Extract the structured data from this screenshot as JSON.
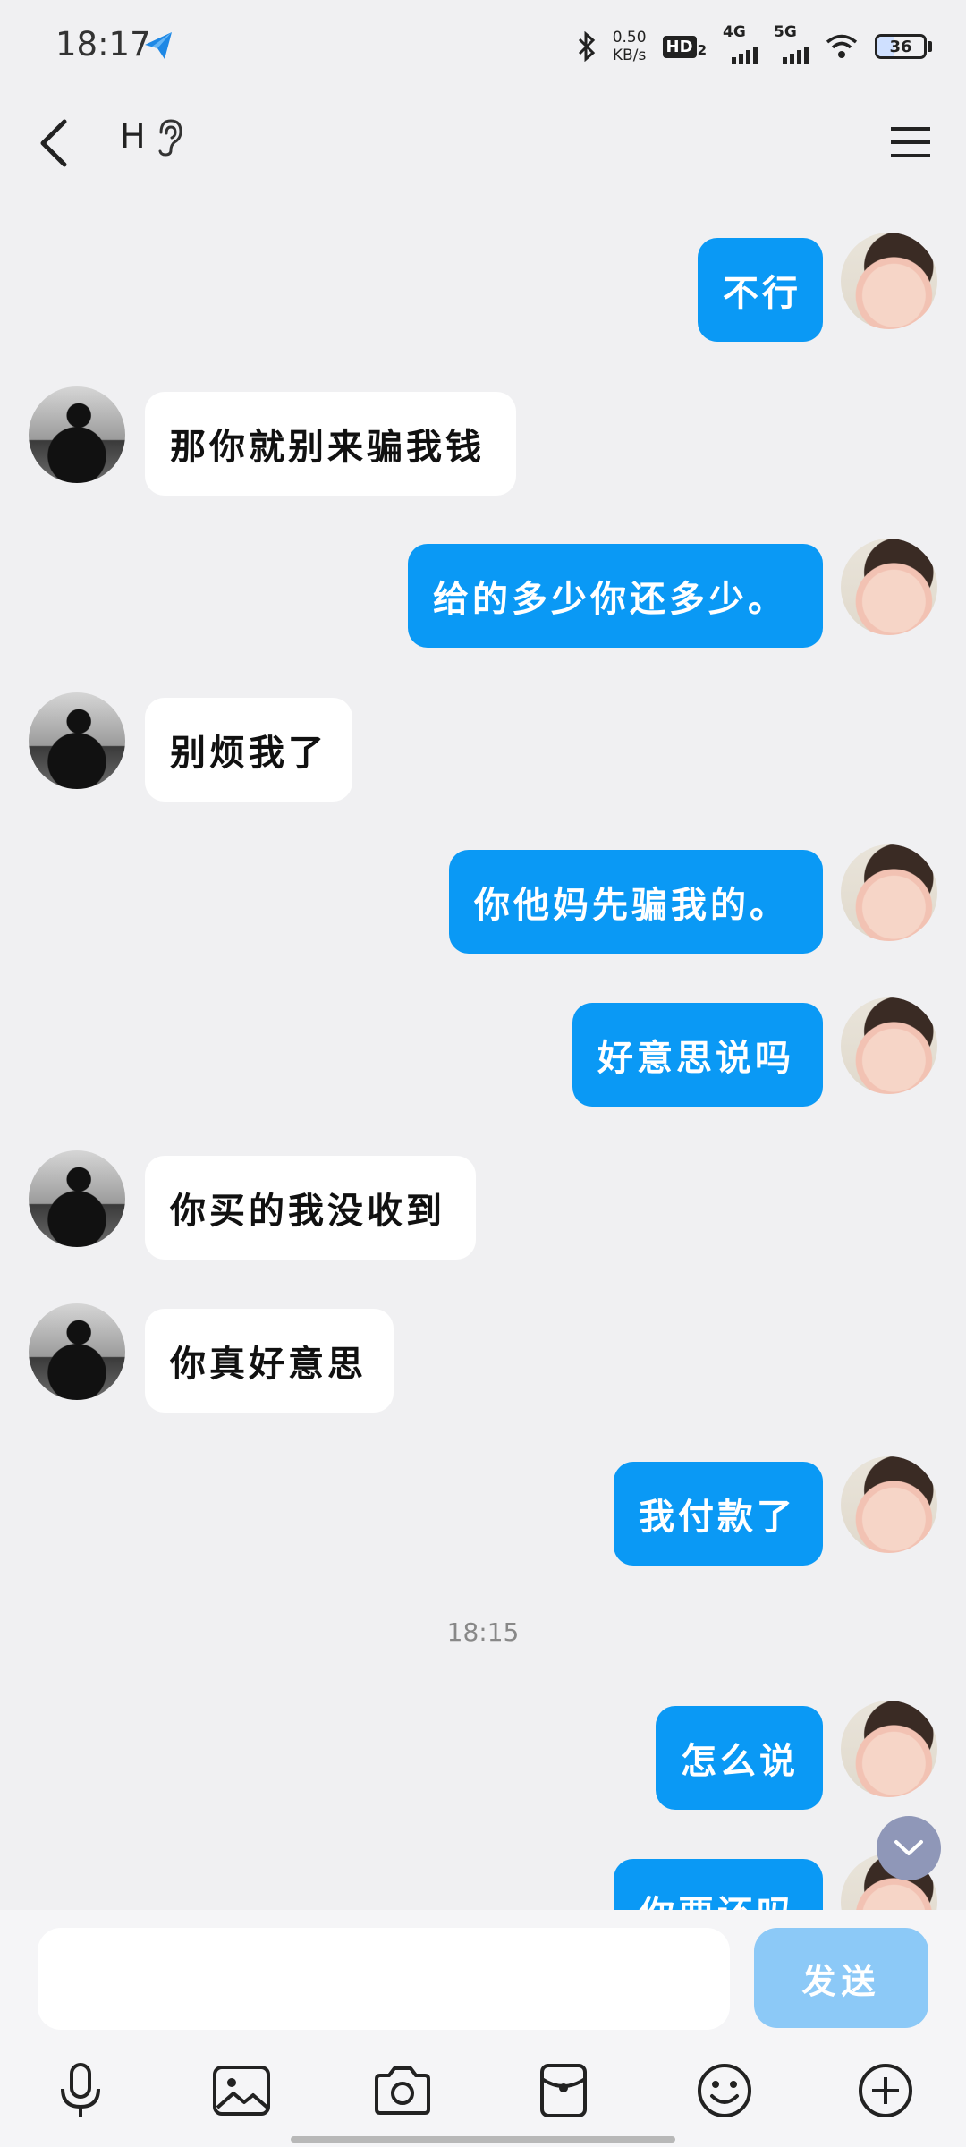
{
  "status_bar": {
    "time": "18:17",
    "net_speed_value": "0.50",
    "net_speed_unit": "KB/s",
    "hd_label": "HD",
    "hd_sub": "2",
    "sim1_label": "4G",
    "sim2_label": "5G",
    "battery_level": "36"
  },
  "header": {
    "title": "H",
    "back_icon": "chevron-left-icon",
    "ear_icon": "ear-icon",
    "menu_icon": "hamburger-menu-icon"
  },
  "messages": [
    {
      "side": "out",
      "text": "不行"
    },
    {
      "side": "in",
      "text": "那你就别来骗我钱"
    },
    {
      "side": "out",
      "text": "给的多少你还多少。"
    },
    {
      "side": "in",
      "text": "别烦我了"
    },
    {
      "side": "out",
      "text": "你他妈先骗我的。"
    },
    {
      "side": "out",
      "text": "好意思说吗"
    },
    {
      "side": "in",
      "text": "你买的我没收到"
    },
    {
      "side": "in",
      "text": "你真好意思"
    },
    {
      "side": "out",
      "text": "我付款了"
    },
    {
      "side": "time",
      "text": "18:15"
    },
    {
      "side": "out",
      "text": "怎么说"
    },
    {
      "side": "out",
      "text": "你要还吗"
    }
  ],
  "input": {
    "placeholder": "",
    "send_label": "发送"
  },
  "toolbar": {
    "icons": [
      "microphone-icon",
      "image-icon",
      "camera-icon",
      "red-packet-icon",
      "emoji-icon",
      "plus-icon"
    ]
  },
  "colors": {
    "outgoing_bubble": "#0a99f5",
    "incoming_bubble": "#ffffff",
    "send_button": "#8cc9f7",
    "background": "#f0f0f2"
  }
}
